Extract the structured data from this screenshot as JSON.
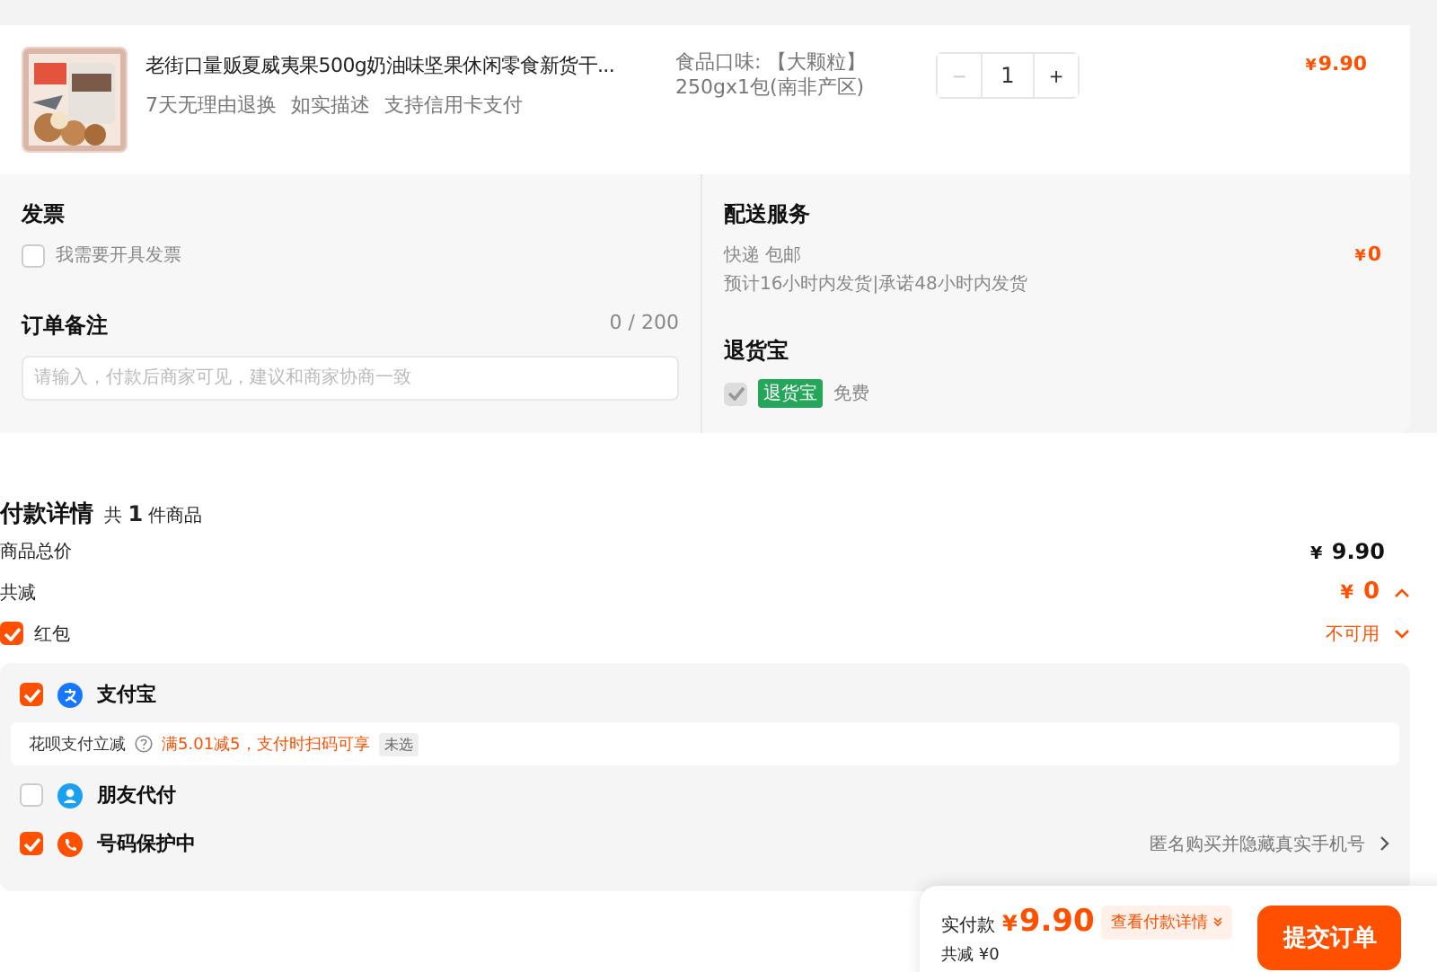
{
  "product": {
    "title": "老街口量贩夏威夷果500g奶油味坚果休闲零食新货干...",
    "services": [
      "7天无理由退换",
      "如实描述",
      "支持信用卡支付"
    ],
    "spec": [
      "食品口味: 【大颗粒】",
      "250gx1包(南非产区)"
    ],
    "quantity": "1",
    "minus": "−",
    "plus": "+",
    "currency": "¥",
    "price": "9.90"
  },
  "invoice": {
    "heading": "发票",
    "label": "我需要开具发票",
    "checked": false
  },
  "note": {
    "heading": "订单备注",
    "counter": "0 / 200",
    "placeholder": "请输入，付款后商家可见，建议和商家协商一致"
  },
  "delivery": {
    "heading": "配送服务",
    "method": "快递 包邮",
    "eta": "预计16小时内发货|承诺48小时内发货",
    "currency": "¥",
    "fee": "0"
  },
  "return_insurance": {
    "heading": "退货宝",
    "checked": true,
    "disabled": true,
    "badge": "退货宝",
    "note": "免费"
  },
  "payment": {
    "title": "付款详情",
    "count": "共 **1** 件商品",
    "rows": [
      {
        "kind": "total",
        "label": "商品总价",
        "currency": "¥",
        "value": "9.90"
      },
      {
        "kind": "discount",
        "label": "共减",
        "currency": "¥",
        "value": "0",
        "expanded": true
      },
      {
        "kind": "coupon",
        "label": "红包",
        "checked": true,
        "value": "不可用",
        "expanded": false
      }
    ],
    "methods": [
      {
        "kind": "alipay",
        "label": "支付宝",
        "checked": true,
        "promo": {
          "label": "花呗支付立减",
          "offer": "满5.01减5，支付时扫码可享",
          "tag": "未选"
        }
      },
      {
        "kind": "friend",
        "label": "朋友代付",
        "checked": false
      },
      {
        "kind": "privacy",
        "label": "号码保护中",
        "checked": true,
        "hint": "匿名购买并隐藏真实手机号"
      }
    ]
  },
  "footer": {
    "label": "实付款",
    "currency": "¥",
    "amount": "9.90",
    "details": "查看付款详情",
    "discount": "共减 ¥0",
    "submit": "提交订单"
  }
}
